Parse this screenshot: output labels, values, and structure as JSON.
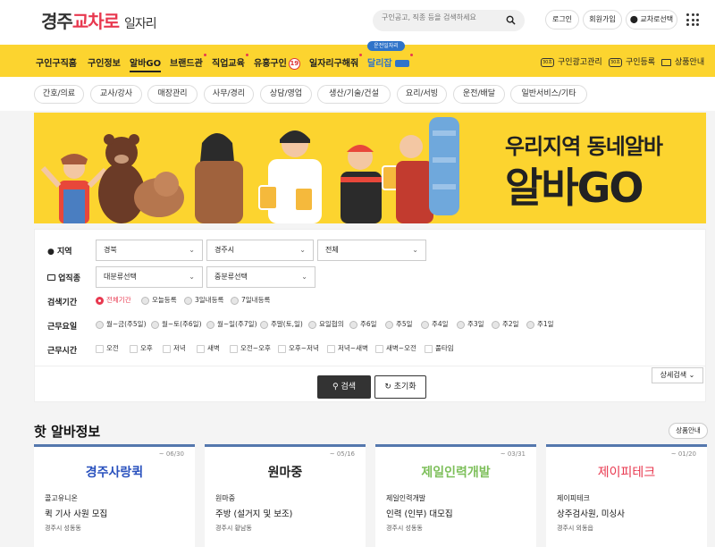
{
  "header": {
    "logo_part1": "경주",
    "logo_part2": "교차로",
    "logo_part3": "일자리",
    "search_placeholder": "구인공고, 직종 등을 검색하세요",
    "login": "로그인",
    "signup": "회원가입",
    "location": "교차로선택"
  },
  "nav": {
    "items": [
      "구인구직홈",
      "구인정보",
      "알바GO",
      "브랜드관",
      "직업교육",
      "유흥구인",
      "일자리구해줘",
      "달리잡"
    ],
    "badge_19": "19",
    "dalijob_pill": "운전일자리",
    "right": {
      "ad_manage": "구인광고관리",
      "ad_register": "구인등록",
      "product_info": "상품안내",
      "ad_manage_icon": "30초",
      "ad_register_icon": "30초"
    }
  },
  "categories": [
    "간호/의료",
    "교사/강사",
    "매장관리",
    "사무/경리",
    "상담/영업",
    "생산/기술/건설",
    "요리/서빙",
    "운전/배달",
    "일반서비스/기타"
  ],
  "banner": {
    "line1": "우리지역 동네알바",
    "line2": "알바GO"
  },
  "filter": {
    "region_label": "지역",
    "region_values": [
      "경북",
      "경주시",
      "전체"
    ],
    "job_label": "업직종",
    "job_values": [
      "대분류선택",
      "중분류선택"
    ],
    "period_label": "검색기간",
    "period_options": [
      "전체기간",
      "오늘등록",
      "3일내등록",
      "7일내등록"
    ],
    "workdays_label": "근무요일",
    "workdays_options": [
      "월~금(주5일)",
      "월~토(주6일)",
      "월~일(주7일)",
      "주말(토,일)",
      "요일협의",
      "주6일",
      "주5일",
      "주4일",
      "주3일",
      "주2일",
      "주1일"
    ],
    "worktime_label": "근무시간",
    "worktime_options": [
      "오전",
      "오후",
      "저녁",
      "새벽",
      "오전~오후",
      "오후~저녁",
      "저녁~새벽",
      "새벽~오전",
      "풀타임"
    ],
    "detail_search": "상세검색",
    "search_btn": "검색",
    "reset_btn": "초기화"
  },
  "hot": {
    "title": "핫 알바정보",
    "more": "상품안내",
    "cards": [
      {
        "date": "~ 06/30",
        "logo": "경주사랑퀵",
        "company": "콜고유니온",
        "title": "퀵 기사 사원 모집",
        "location": "경주시 성동동",
        "logo_color": "#2a52be"
      },
      {
        "date": "~ 05/16",
        "logo": "원마중",
        "company": "원마중",
        "title": "주방 (설거지 및 보조)",
        "location": "경주시 황남동",
        "logo_color": "#222222"
      },
      {
        "date": "~ 03/31",
        "logo": "제일인력개발",
        "company": "제일인력개발",
        "title": "인력 (인부) 대모집",
        "location": "경주시 성동동",
        "logo_color": "#7dbf5a"
      },
      {
        "date": "~ 01/20",
        "logo": "제이피테크",
        "company": "제이피테크",
        "title": "상주검사원, 미싱사",
        "location": "경주시 외동읍",
        "logo_color": "#e8384f"
      }
    ]
  }
}
